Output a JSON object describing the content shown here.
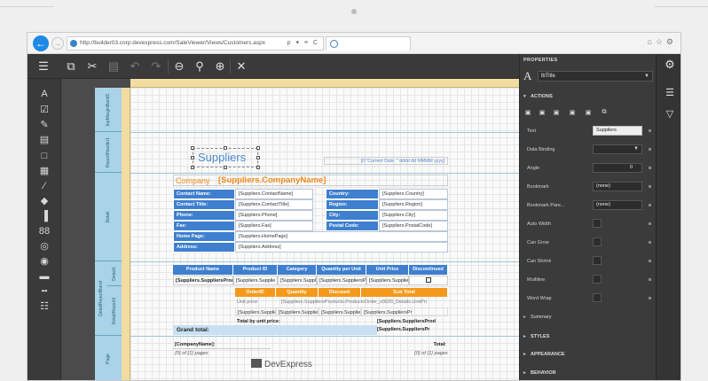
{
  "browser": {
    "url": "http://builder03.corp.devexpress.com/SaleViewer/Views/Customers.aspx",
    "url_tools": "ρ ▾ ≡ C",
    "right_icons": "⌂☆⚙"
  },
  "toolbar": {
    "buttons": [
      "copy-icon",
      "cut-icon",
      "paste-icon",
      "undo-icon",
      "redo-icon",
      "zoom-out-icon",
      "zoom-icon",
      "zoom-in-icon",
      "close-icon"
    ]
  },
  "toolbox": {
    "items": [
      "label-icon",
      "checkbox-icon",
      "richtext-icon",
      "picture-icon",
      "panel-icon",
      "table-icon",
      "line-icon",
      "shape-icon",
      "barcode-icon",
      "zipcode-icon",
      "gauge-icon",
      "chart-icon",
      "pagebreak-icon",
      "crossband-icon"
    ]
  },
  "bands": {
    "top_margin": "topMarginBand1",
    "report_header": "ReportHeader1",
    "detail": "Detail",
    "detail_report": "DetailReportBand",
    "detail1": "Detail1",
    "detail_report2": "DetailReport2",
    "d": "D",
    "gh": "Gr",
    "group": "Gr",
    "page_footer": "Page"
  },
  "report": {
    "title": "Suppliers",
    "date_expr": "[0:\"Current Date: \" dddd  dd MMMM yyyy]",
    "company_label": "Company",
    "company_value": "[Suppliers.CompanyName]",
    "fields_left": [
      {
        "k": "Contact Name:",
        "v": "[Suppliers.ContactName]"
      },
      {
        "k": "Contact Title:",
        "v": "[Suppliers.ContactTitle]"
      },
      {
        "k": "Phone:",
        "v": "[Suppliers.Phone]"
      },
      {
        "k": "Fax:",
        "v": "[Suppliers.Fax]"
      },
      {
        "k": "Home Page:",
        "v": "[Suppliers.HomePage]"
      },
      {
        "k": "Address:",
        "v": "[Suppliers.Address]"
      }
    ],
    "fields_right": [
      {
        "k": "Country:",
        "v": "[Suppliers.Country]"
      },
      {
        "k": "Region:",
        "v": "[Suppliers.Region]"
      },
      {
        "k": "City:",
        "v": "[Suppliers.City]"
      },
      {
        "k": "Postal Code:",
        "v": "[Suppliers.PostalCode]"
      }
    ],
    "product_headers": [
      "Product Name",
      "Product ID",
      "Category",
      "Quantity per Unit",
      "Unit Price",
      "Discontinued"
    ],
    "product_row": [
      "[Suppliers.SuppliersProd",
      "[Suppliers.Supplie",
      "[Suppliers.Supplie",
      "[Suppliers.SuppliersPro",
      "[Suppliers.Supplie"
    ],
    "order_headers": [
      "OrderID",
      "Quantity",
      "Discount",
      "Sub Total"
    ],
    "unit_price_label": "Unit price:",
    "unit_price_val": "[Suppliers.SuppliersProducts.ProductsOrder_x0020_Details.UnitPri",
    "order_row": [
      "[Suppliers.Suppliers",
      "[Suppliers.SuppliersPr",
      "[Suppliers.Suppliersh",
      "[Suppliers.SuppliersPr"
    ],
    "total_by_unit": "Total by unit price:",
    "total_by_unit_val": "[Suppliers.SuppliersProd",
    "total_val2": "[Suppliers.SuppliersPr",
    "grand_total": "Grand total:",
    "company_name_footer": "[CompanyName]:",
    "pages": "{0} of {1} pages",
    "total": "Total:",
    "pages2": "{0} of {1} pages",
    "logo": "DevExpress"
  },
  "properties": {
    "header": "PROPERTIES",
    "object": "lbTitle",
    "actions": "ACTIONS",
    "rows": [
      {
        "label": "Text",
        "value": "Suppliers",
        "kind": "field"
      },
      {
        "label": "Data Binding",
        "value": "",
        "kind": "select"
      },
      {
        "label": "Angle",
        "value": "0",
        "kind": "spin"
      },
      {
        "label": "Bookmark",
        "value": "(none)",
        "kind": "select"
      },
      {
        "label": "Bookmark Pare...",
        "value": "(none)",
        "kind": "select"
      },
      {
        "label": "Auto Width",
        "value": "",
        "kind": "check"
      },
      {
        "label": "Can Grow",
        "value": "",
        "kind": "check"
      },
      {
        "label": "Can Shrink",
        "value": "",
        "kind": "check"
      },
      {
        "label": "Multiline",
        "value": "",
        "kind": "check"
      },
      {
        "label": "Word Wrap",
        "value": "",
        "kind": "check"
      }
    ],
    "summary": "Summary",
    "styles": "STYLES",
    "appearance": "APPEARANCE",
    "behavior": "BEHAVIOR"
  }
}
